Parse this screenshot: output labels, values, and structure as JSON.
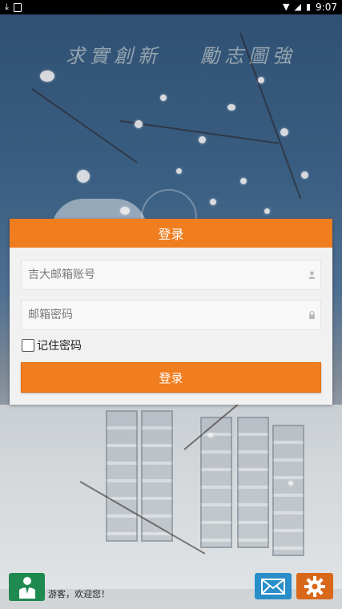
{
  "status_bar": {
    "time": "9:07"
  },
  "background": {
    "calligraphy_left": "求實創新",
    "calligraphy_right": "勵志圖強"
  },
  "login": {
    "title": "登录",
    "email_placeholder": "吉大邮箱账号",
    "password_placeholder": "邮箱密码",
    "remember_label": "记住密码",
    "submit_label": "登录"
  },
  "bottom_bar": {
    "welcome_text": "游客，欢迎您！"
  },
  "colors": {
    "accent_orange": "#f07d1e",
    "avatar_green": "#1f8a50",
    "mail_blue": "#2a8ec9",
    "settings_orange": "#d9681b"
  },
  "icons": {
    "user": "user-icon",
    "lock": "lock-icon",
    "mail": "mail-icon",
    "settings": "gear-icon",
    "avatar": "person-icon"
  }
}
